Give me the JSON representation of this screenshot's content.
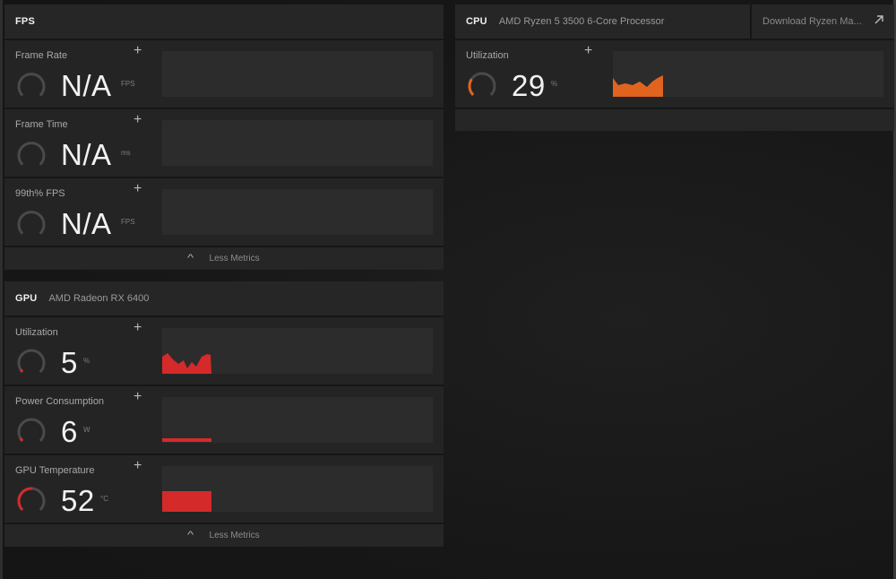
{
  "fps_panel": {
    "title": "FPS",
    "metrics": [
      {
        "name": "Frame Rate",
        "value": "N/A",
        "unit": "FPS",
        "plus": "+"
      },
      {
        "name": "Frame Time",
        "value": "N/A",
        "unit": "ms",
        "plus": "+"
      },
      {
        "name": "99th% FPS",
        "value": "N/A",
        "unit": "FPS",
        "plus": "+"
      }
    ],
    "less_metrics": "Less Metrics",
    "chevron": "^"
  },
  "gpu_panel": {
    "title": "GPU",
    "subtitle": "AMD Radeon RX 6400",
    "metrics": [
      {
        "name": "Utilization",
        "value": "5",
        "unit": "%",
        "plus": "+",
        "gauge_fraction": 0.05,
        "color": "#d42a2a"
      },
      {
        "name": "Power Consumption",
        "value": "6",
        "unit": "W",
        "plus": "+",
        "gauge_fraction": 0.06,
        "color": "#d42a2a"
      },
      {
        "name": "GPU Temperature",
        "value": "52",
        "unit": "°C",
        "plus": "+",
        "gauge_fraction": 0.52,
        "color": "#d42a2a"
      }
    ],
    "less_metrics": "Less Metrics",
    "chevron": "^"
  },
  "cpu_panel": {
    "title": "CPU",
    "subtitle": "AMD Ryzen 5 3500 6-Core Processor",
    "download_label": "Download Ryzen Ma...",
    "metrics": [
      {
        "name": "Utilization",
        "value": "29",
        "unit": "%",
        "plus": "+",
        "gauge_fraction": 0.29,
        "color": "#e0641e"
      }
    ]
  },
  "colors": {
    "gpu_accent": "#d42a2a",
    "cpu_accent": "#e0641e",
    "gauge_track": "#4a4a4a"
  }
}
